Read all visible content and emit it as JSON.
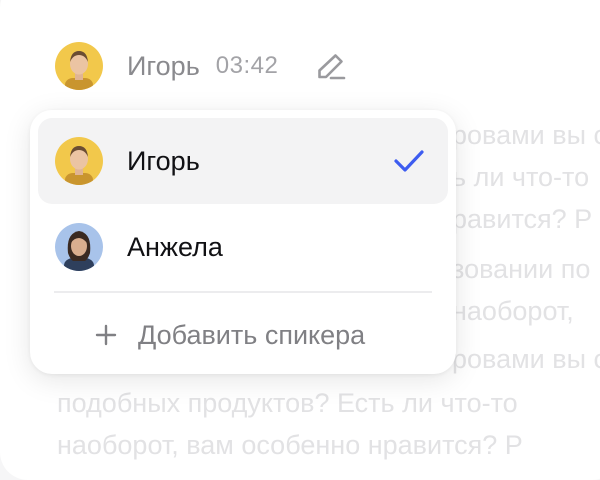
{
  "header": {
    "speaker_name": "Игорь",
    "timestamp": "03:42",
    "edit_icon": "pencil-icon"
  },
  "transcript_lines": [
    "ровами вы с",
    "ь ли что-то",
    "равится? Р",
    "зовании по",
    "наоборот,",
    "ровами вы с",
    "подобных продуктов? Есть ли что-то",
    "наоборот, вам особенно нравится? Р"
  ],
  "dropdown": {
    "speakers": [
      {
        "name": "Игорь",
        "selected": true
      },
      {
        "name": "Анжела",
        "selected": false
      }
    ],
    "add_label": "Добавить спикера"
  },
  "colors": {
    "accent": "#3d5cf0",
    "selected_bg": "#f3f3f4",
    "muted_text": "#8a8a8e"
  }
}
